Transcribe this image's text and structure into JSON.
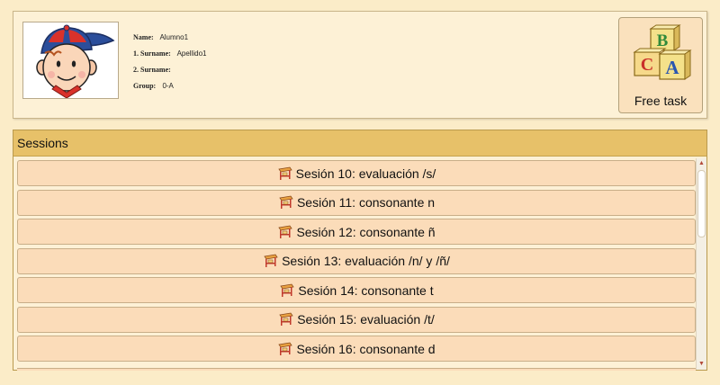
{
  "profile": {
    "name_label": "Name:",
    "name_value": "Alumno1",
    "surname1_label": "1. Surname:",
    "surname1_value": "Apellido1",
    "surname2_label": "2. Surname:",
    "surname2_value": "",
    "group_label": "Group:",
    "group_value": "0-A"
  },
  "free_task": {
    "label": "Free task",
    "icon": "abc-blocks-icon"
  },
  "sessions": {
    "title": "Sessions",
    "items": [
      {
        "label": "Sesión 10: evaluación /s/"
      },
      {
        "label": "Sesión 11: consonante n"
      },
      {
        "label": "Sesión 12: consonante ñ"
      },
      {
        "label": "Sesión 13: evaluación /n/ y /ñ/"
      },
      {
        "label": "Sesión 14: consonante t"
      },
      {
        "label": "Sesión 15: evaluación /t/"
      },
      {
        "label": "Sesión 16: consonante d"
      }
    ],
    "item_icon": "school-desk-icon"
  }
}
